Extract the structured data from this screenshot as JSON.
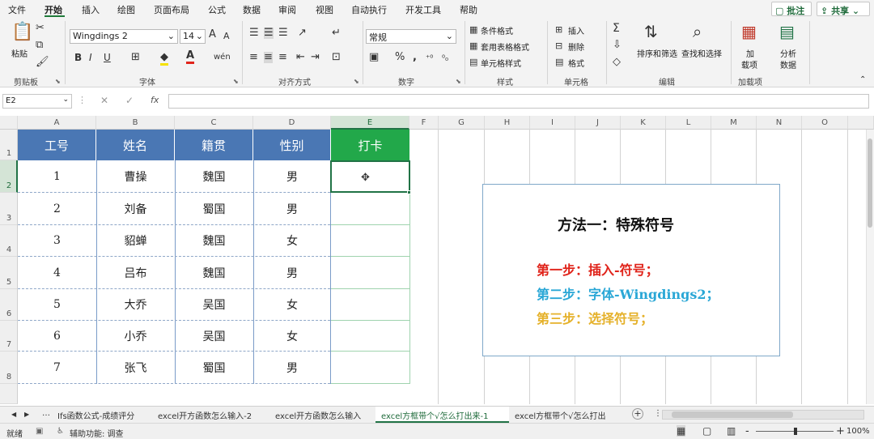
{
  "menu": {
    "tabs": [
      "文件",
      "开始",
      "插入",
      "绘图",
      "页面布局",
      "公式",
      "数据",
      "审阅",
      "视图",
      "自动执行",
      "开发工具",
      "帮助"
    ],
    "active": "开始",
    "comments_label": "批注",
    "share_label": "共享"
  },
  "ribbon": {
    "clipboard": {
      "paste": "粘贴",
      "group": "剪贴板"
    },
    "font": {
      "name": "Wingdings 2",
      "size": "14",
      "grow": "A",
      "shrink": "A",
      "bold": "B",
      "italic": "I",
      "underline": "U",
      "wen": "wén",
      "group": "字体"
    },
    "alignment": {
      "group": "对齐方式"
    },
    "number": {
      "format": "常规",
      "percent": "%",
      "group": "数字"
    },
    "styles": {
      "conditional": "条件格式",
      "table": "套用表格格式",
      "cell": "单元格样式",
      "group": "样式"
    },
    "cells": {
      "insert": "插入",
      "delete": "删除",
      "format": "格式",
      "group": "单元格"
    },
    "editing": {
      "sort": "排序和筛选",
      "find": "查找和选择",
      "group": "编辑"
    },
    "addins": {
      "addin_1": "加",
      "addin_2": "载项",
      "analyze_1": "分析",
      "analyze_2": "数据",
      "group": "加载项"
    }
  },
  "formula_bar": {
    "name_box": "E2",
    "fx": "fx",
    "value": ""
  },
  "grid": {
    "columns": [
      "A",
      "B",
      "C",
      "D",
      "E",
      "F",
      "G",
      "H",
      "I",
      "J",
      "K",
      "L",
      "M",
      "N",
      "O"
    ],
    "rows": [
      "1",
      "2",
      "3",
      "4",
      "5",
      "6",
      "7",
      "8"
    ],
    "selected_cell": "E2",
    "headers": [
      "工号",
      "姓名",
      "籍贯",
      "性别",
      "打卡"
    ],
    "data": [
      [
        "1",
        "曹操",
        "魏国",
        "男",
        ""
      ],
      [
        "2",
        "刘备",
        "蜀国",
        "男",
        ""
      ],
      [
        "3",
        "貂蝉",
        "魏国",
        "女",
        ""
      ],
      [
        "4",
        "吕布",
        "魏国",
        "男",
        ""
      ],
      [
        "5",
        "大乔",
        "吴国",
        "女",
        ""
      ],
      [
        "6",
        "小乔",
        "吴国",
        "女",
        ""
      ],
      [
        "7",
        "张飞",
        "蜀国",
        "男",
        ""
      ]
    ],
    "colors": {
      "header_blue": "#4a77b4",
      "header_green": "#22a84a"
    }
  },
  "method_box": {
    "title": "方法一：特殊符号",
    "step1": "第一步：插入-符号；",
    "step2": "第二步：字体-Wingdings2；",
    "step3": "第三步：选择符号；",
    "colors": {
      "title": "#111111",
      "step1": "#e0241b",
      "step2": "#2aa7d6",
      "step3": "#e5b12a"
    }
  },
  "sheets": {
    "tabs": [
      "Ifs函数公式-成绩评分",
      "excel开方函数怎么输入-2",
      "excel开方函数怎么输入",
      "excel方框带个√怎么打出来-1",
      "excel方框带个√怎么打出"
    ],
    "active_index": 3,
    "add_label": "+"
  },
  "status": {
    "ready": "就绪",
    "accessibility": "辅助功能: 调查",
    "zoom": "100%",
    "zoom_minus": "-",
    "zoom_plus": "+"
  }
}
